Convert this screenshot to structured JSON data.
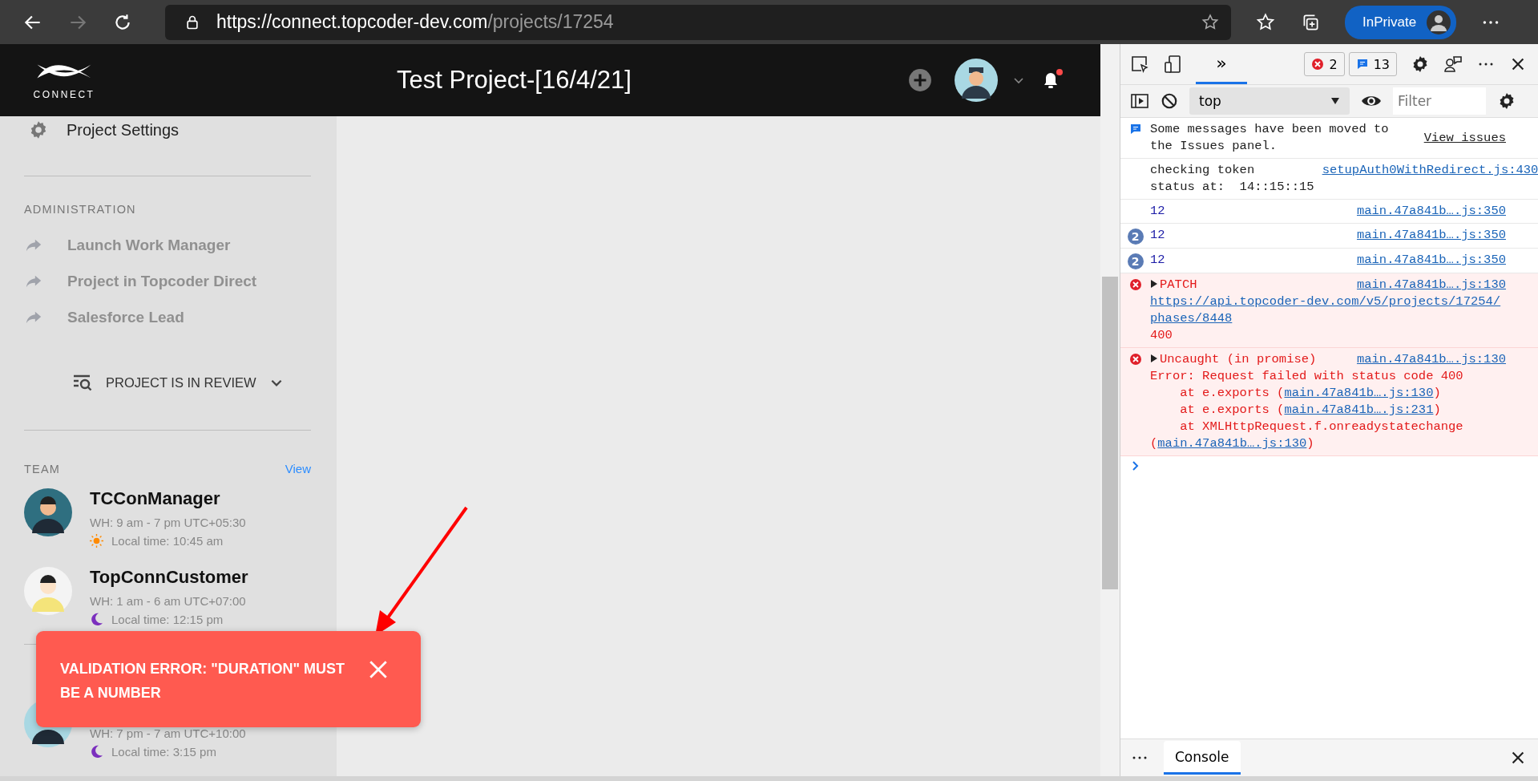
{
  "browser": {
    "url_host": "https://connect.topcoder-dev.com",
    "url_path": "/projects/17254",
    "profile_label": "InPrivate"
  },
  "header": {
    "logo_text": "CONNECT",
    "title": "Test Project-[16/4/21]",
    "has_notification": true
  },
  "sidebar": {
    "settings_label": "Project Settings",
    "admin_heading": "ADMINISTRATION",
    "admin_items": [
      "Launch Work Manager",
      "Project in Topcoder Direct",
      "Salesforce Lead"
    ],
    "status_label": "PROJECT IS IN REVIEW",
    "team_heading": "TEAM",
    "team_link": "View",
    "members": [
      {
        "name": "TCConManager",
        "hours": "WH: 9 am - 7 pm UTC+05:30",
        "local_time": "Local time: 10:45 am",
        "kind": "day"
      },
      {
        "name": "TopConnCustomer",
        "hours": "WH: 1 am - 6 am UTC+07:00",
        "local_time": "Local time: 12:15 pm",
        "kind": "night"
      },
      {
        "hours": "WH: 7 pm - 7 am UTC+10:00",
        "local_time": "Local time: 3:15 pm",
        "kind": "night"
      }
    ]
  },
  "toast": {
    "message": "VALIDATION ERROR: \"DURATION\" MUST BE A NUMBER"
  },
  "devtools": {
    "more_tabs": {
      "label": "»",
      "selected": true
    },
    "error_count": "2",
    "message_count": "13",
    "context": "top",
    "filter_placeholder": "Filter",
    "messages": [
      {
        "kind": "info",
        "text": "Some messages have been moved to the Issues panel.",
        "link": "View issues"
      },
      {
        "kind": "log",
        "lines": [
          "checking token",
          "status at:  14::15::15"
        ],
        "source": "setupAuth0WithRedirect.js:430"
      },
      {
        "kind": "value",
        "value": "12",
        "source": "main.47a841b….js:350"
      },
      {
        "kind": "value",
        "count": "2",
        "value": "12",
        "source": "main.47a841b….js:350"
      },
      {
        "kind": "value",
        "count": "2",
        "value": "12",
        "source": "main.47a841b….js:350"
      },
      {
        "kind": "error",
        "label": "PATCH",
        "url": "https://api.topcoder-dev.com/v5/projects/17254/phases/8448",
        "tail": "400",
        "source": "main.47a841b….js:130"
      },
      {
        "kind": "error",
        "label": "Uncaught (in promise)",
        "tail": "Error: Request failed with status code 400",
        "source": "main.47a841b….js:130",
        "stack": [
          {
            "text": "at e.exports (",
            "link": "main.47a841b….js:130",
            "end": ")"
          },
          {
            "text": "at e.exports (",
            "link": "main.47a841b….js:231",
            "end": ")"
          },
          {
            "text": "at XMLHttpRequest.f.onreadystatechange (",
            "link": "main.47a841b….js:130",
            "end": ")"
          }
        ]
      }
    ],
    "drawer_tabs": [
      {
        "label": "Console",
        "selected": true
      }
    ]
  }
}
